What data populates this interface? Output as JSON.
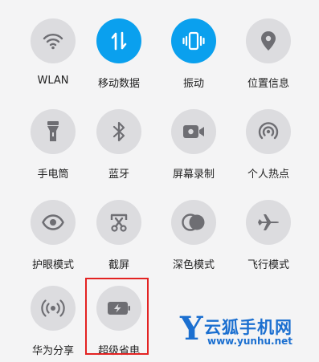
{
  "colors": {
    "active_tile": "#0aa0ee",
    "inactive_tile": "#dcdcdf",
    "icon_inactive": "#6e6e73",
    "highlight": "#e32222",
    "watermark": "#1b6fd0"
  },
  "tiles": [
    {
      "label": "WLAN",
      "icon": "wifi-icon",
      "active": false
    },
    {
      "label": "移动数据",
      "icon": "mobile-data-icon",
      "active": true
    },
    {
      "label": "振动",
      "icon": "vibrate-icon",
      "active": true
    },
    {
      "label": "位置信息",
      "icon": "location-pin-icon",
      "active": false
    },
    {
      "label": "手电筒",
      "icon": "flashlight-icon",
      "active": false
    },
    {
      "label": "蓝牙",
      "icon": "bluetooth-icon",
      "active": false
    },
    {
      "label": "屏幕录制",
      "icon": "screen-record-icon",
      "active": false
    },
    {
      "label": "个人热点",
      "icon": "hotspot-icon",
      "active": false
    },
    {
      "label": "护眼模式",
      "icon": "eye-icon",
      "active": false
    },
    {
      "label": "截屏",
      "icon": "screenshot-icon",
      "active": false
    },
    {
      "label": "深色模式",
      "icon": "dark-mode-icon",
      "active": false
    },
    {
      "label": "飞行模式",
      "icon": "airplane-icon",
      "active": false
    },
    {
      "label": "华为分享",
      "icon": "huawei-share-icon",
      "active": false
    },
    {
      "label": "超级省电",
      "icon": "battery-saver-icon",
      "active": false
    }
  ],
  "watermark": {
    "logo_letter": "Y",
    "name": "云狐手机网",
    "url": "www.yunhu.net"
  }
}
